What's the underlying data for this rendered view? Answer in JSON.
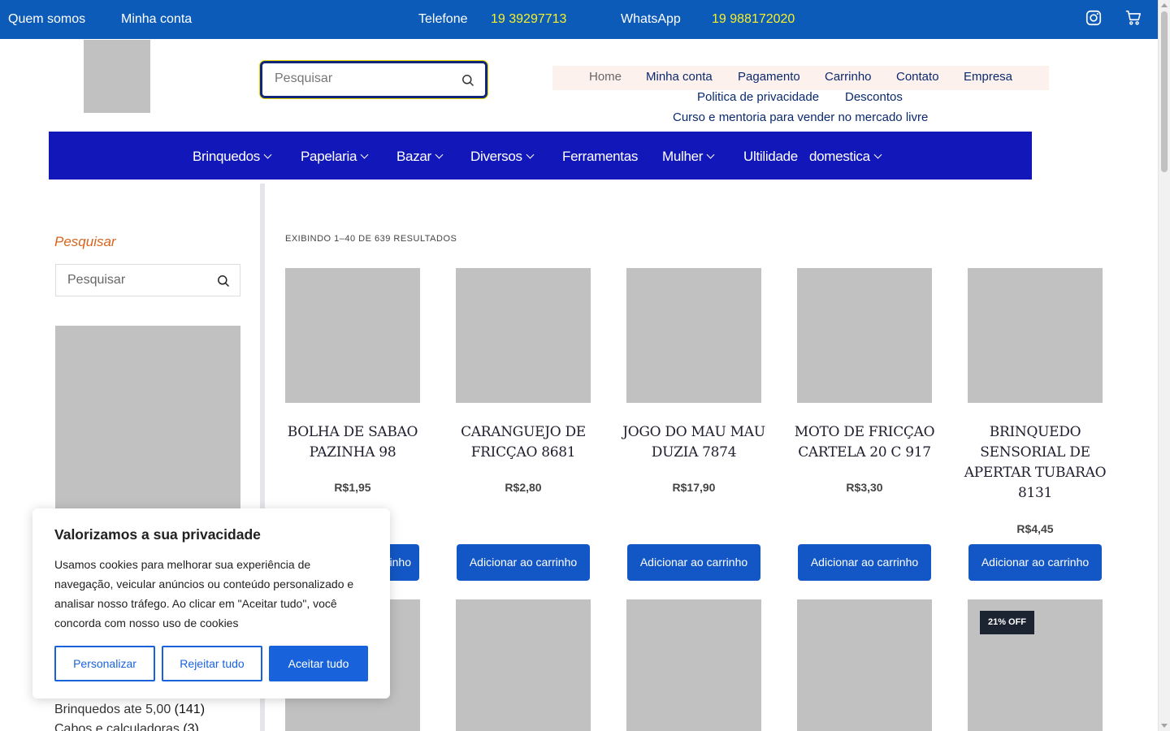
{
  "topbar": {
    "about": "Quem somos",
    "account": "Minha conta",
    "phone_label": "Telefone",
    "phone": "19 39297713",
    "whatsapp_label": "WhatsApp",
    "whatsapp": "19 988172020"
  },
  "header": {
    "search_placeholder": "Pesquisar",
    "nav": [
      "Home",
      "Minha conta",
      "Pagamento",
      "Carrinho",
      "Contato",
      "Empresa",
      "Politica de privacidade",
      "Descontos",
      "Curso e mentoria para vender no mercado livre"
    ]
  },
  "mainnav": {
    "items": [
      "Brinquedos",
      "Papelaria",
      "Bazar",
      "Diversos",
      "Ferramentas",
      "Mulher",
      "Ultilidade",
      "domestica"
    ]
  },
  "sidebar": {
    "title": "Pesquisar",
    "search_placeholder": "Pesquisar",
    "categories": [
      {
        "name": "Brinquedos ate 5,00",
        "count": "(141)"
      },
      {
        "name": "Cabos e calculadoras",
        "count": "(3)"
      }
    ]
  },
  "results_text": "EXIBINDO 1–40 DE 639 RESULTADOS",
  "products": [
    {
      "name": "BOLHA DE SABAO PAZINHA 98",
      "price": "R$1,95",
      "button": "Adicionar ao carrinho"
    },
    {
      "name": "CARANGUEJO DE FRICÇAO 8681",
      "price": "R$2,80",
      "button": "Adicionar ao carrinho"
    },
    {
      "name": "JOGO DO MAU MAU DUZIA 7874",
      "price": "R$17,90",
      "button": "Adicionar ao carrinho"
    },
    {
      "name": "MOTO DE FRICÇAO CARTELA 20 C 917",
      "price": "R$3,30",
      "button": "Adicionar ao carrinho"
    },
    {
      "name": "BRINQUEDO SENSORIAL DE APERTAR TUBARAO 8131",
      "price": "R$4,45",
      "button": "Adicionar ao carrinho"
    }
  ],
  "badge": "21% OFF",
  "first_button_visible": "rinho",
  "cookie": {
    "title": "Valorizamos a sua privacidade",
    "text": "Usamos cookies para melhorar sua experiência de navegação, veicular anúncios ou conteúdo personalizado e analisar nosso tráfego. Ao clicar em \"Aceitar tudo\", você concorda com nosso uso de cookies",
    "customize": "Personalizar",
    "reject": "Rejeitar tudo",
    "accept": "Aceitar tudo"
  },
  "colors": {
    "topbar": "#0d5bb8",
    "mainnav": "#1117b8",
    "button": "#1357c6",
    "accent_yellow": "#f7f028",
    "sidebar_title": "#d9631c"
  }
}
